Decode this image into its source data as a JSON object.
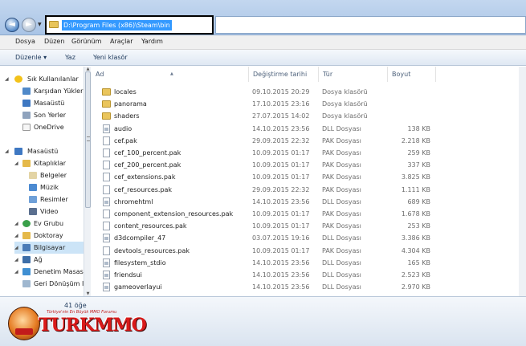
{
  "address": {
    "path": "D:\\Program Files (x86)\\Steam\\bin"
  },
  "menu": [
    "Dosya",
    "Düzen",
    "Görünüm",
    "Araçlar",
    "Yardım"
  ],
  "toolbar": {
    "organize": "Düzenle ▾",
    "print": "Yaz",
    "new_folder": "Yeni klasör"
  },
  "nav": {
    "items": [
      {
        "label": "Sık Kullanılanlar",
        "icon": "star-icon"
      },
      {
        "label": "Karşıdan Yükler",
        "icon": "download-folder-icon"
      },
      {
        "label": "Masaüstü",
        "icon": "desktop-icon"
      },
      {
        "label": "Son Yerler",
        "icon": "recent-places-icon"
      },
      {
        "label": "OneDrive",
        "icon": "onedrive-icon"
      },
      {
        "label": "Masaüstü",
        "icon": "desktop-icon"
      },
      {
        "label": "Kitaplıklar",
        "icon": "libraries-icon"
      },
      {
        "label": "Belgeler",
        "icon": "documents-icon"
      },
      {
        "label": "Müzik",
        "icon": "music-icon"
      },
      {
        "label": "Resimler",
        "icon": "pictures-icon"
      },
      {
        "label": "Video",
        "icon": "video-icon"
      },
      {
        "label": "Ev Grubu",
        "icon": "homegroup-icon"
      },
      {
        "label": "Doktoray",
        "icon": "user-folder-icon"
      },
      {
        "label": "Bilgisayar",
        "icon": "computer-icon"
      },
      {
        "label": "Ağ",
        "icon": "network-icon"
      },
      {
        "label": "Denetim Masas",
        "icon": "control-panel-icon"
      },
      {
        "label": "Geri Dönüşüm I",
        "icon": "recycle-bin-icon"
      }
    ]
  },
  "columns": {
    "name": "Ad",
    "date": "Değiştirme tarihi",
    "type": "Tür",
    "size": "Boyut"
  },
  "files": [
    {
      "name": "locales",
      "date": "09.10.2015 20:29",
      "type": "Dosya klasörü",
      "size": "",
      "kind": "folder"
    },
    {
      "name": "panorama",
      "date": "17.10.2015 23:16",
      "type": "Dosya klasörü",
      "size": "",
      "kind": "folder"
    },
    {
      "name": "shaders",
      "date": "27.07.2015 14:02",
      "type": "Dosya klasörü",
      "size": "",
      "kind": "folder"
    },
    {
      "name": "audio",
      "date": "14.10.2015 23:56",
      "type": "DLL Dosyası",
      "size": "138 KB",
      "kind": "dll"
    },
    {
      "name": "cef.pak",
      "date": "29.09.2015 22:32",
      "type": "PAK Dosyası",
      "size": "2.218 KB",
      "kind": "pak"
    },
    {
      "name": "cef_100_percent.pak",
      "date": "10.09.2015 01:17",
      "type": "PAK Dosyası",
      "size": "259 KB",
      "kind": "pak"
    },
    {
      "name": "cef_200_percent.pak",
      "date": "10.09.2015 01:17",
      "type": "PAK Dosyası",
      "size": "337 KB",
      "kind": "pak"
    },
    {
      "name": "cef_extensions.pak",
      "date": "10.09.2015 01:17",
      "type": "PAK Dosyası",
      "size": "3.825 KB",
      "kind": "pak"
    },
    {
      "name": "cef_resources.pak",
      "date": "29.09.2015 22:32",
      "type": "PAK Dosyası",
      "size": "1.111 KB",
      "kind": "pak"
    },
    {
      "name": "chromehtml",
      "date": "14.10.2015 23:56",
      "type": "DLL Dosyası",
      "size": "689 KB",
      "kind": "dll"
    },
    {
      "name": "component_extension_resources.pak",
      "date": "10.09.2015 01:17",
      "type": "PAK Dosyası",
      "size": "1.678 KB",
      "kind": "pak"
    },
    {
      "name": "content_resources.pak",
      "date": "10.09.2015 01:17",
      "type": "PAK Dosyası",
      "size": "253 KB",
      "kind": "pak"
    },
    {
      "name": "d3dcompiler_47",
      "date": "03.07.2015 19:16",
      "type": "DLL Dosyası",
      "size": "3.386 KB",
      "kind": "dll"
    },
    {
      "name": "devtools_resources.pak",
      "date": "10.09.2015 01:17",
      "type": "PAK Dosyası",
      "size": "4.304 KB",
      "kind": "pak"
    },
    {
      "name": "filesystem_stdio",
      "date": "14.10.2015 23:56",
      "type": "DLL Dosyası",
      "size": "165 KB",
      "kind": "dll"
    },
    {
      "name": "friendsui",
      "date": "14.10.2015 23:56",
      "type": "DLL Dosyası",
      "size": "2.523 KB",
      "kind": "dll"
    },
    {
      "name": "gameoverlayui",
      "date": "14.10.2015 23:56",
      "type": "DLL Dosyası",
      "size": "2.970 KB",
      "kind": "dll"
    }
  ],
  "status": {
    "count": "41 öğe"
  },
  "watermark": {
    "brand": "TURKMMO",
    "tagline": "Türkiye'nin En Büyük MMO Forumu"
  }
}
